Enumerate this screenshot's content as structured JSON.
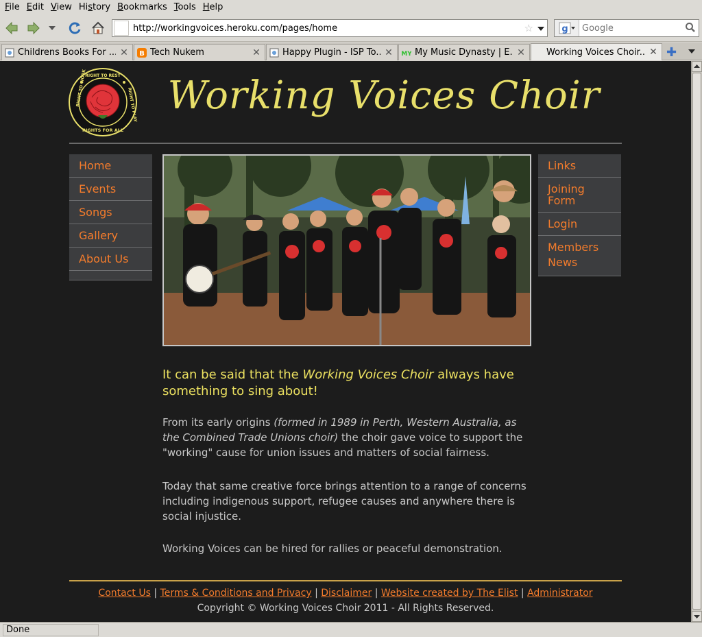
{
  "browser": {
    "menu": [
      "File",
      "Edit",
      "View",
      "History",
      "Bookmarks",
      "Tools",
      "Help"
    ],
    "menu_access": [
      "F",
      "E",
      "V",
      "s",
      "B",
      "T",
      "H"
    ],
    "url": "http://workingvoices.heroku.com/pages/home",
    "search_placeholder": "Google",
    "tabs": [
      {
        "label": "Childrens Books For ...",
        "favicon": "page-icon"
      },
      {
        "label": "Tech Nukem",
        "favicon": "blogger-icon"
      },
      {
        "label": "Happy Plugin - ISP To...",
        "favicon": "page-icon"
      },
      {
        "label": "My Music Dynasty | E...",
        "favicon": "my-icon"
      },
      {
        "label": "Working Voices Choir...",
        "favicon": "none"
      }
    ],
    "status": "Done"
  },
  "site": {
    "title": "Working Voices Choir",
    "logo_text_top": "RIGHT TO WORK · RIGHT TO REST · RIGHT TO PLAY",
    "logo_text_bottom": "RIGHTS FOR ALL",
    "nav_left": [
      "Home",
      "Events",
      "Songs",
      "Gallery",
      "About Us"
    ],
    "nav_right": [
      "Links",
      "Joining Form",
      "Login",
      "Members News"
    ],
    "intro_a": "It can be said that the ",
    "intro_em": "Working Voices Choir",
    "intro_b": " always have something to sing about!",
    "p1_a": "From its early origins ",
    "p1_em": "(formed in 1989 in Perth, Western Australia, as the Combined Trade Unions choir)",
    "p1_b": " the choir gave voice to support the \"working\" cause for union issues and matters of social fairness.",
    "p2": "Today that same creative force brings attention to a range of concerns including indigenous support, refugee causes and anywhere there is social injustice.",
    "p3": "Working Voices can be hired for rallies or peaceful demonstration.",
    "footer_links": [
      "Contact Us",
      "Terms & Conditions and Privacy",
      "Disclaimer",
      "Website created by The Elist",
      "Administrator"
    ],
    "copyright": "Copyright © Working Voices Choir 2011 - All Rights Reserved."
  },
  "colors": {
    "accent_orange": "#f47c2c",
    "title_yellow": "#e8df6a",
    "background": "#1c1c1c",
    "nav_bg": "#3c3d3f"
  }
}
